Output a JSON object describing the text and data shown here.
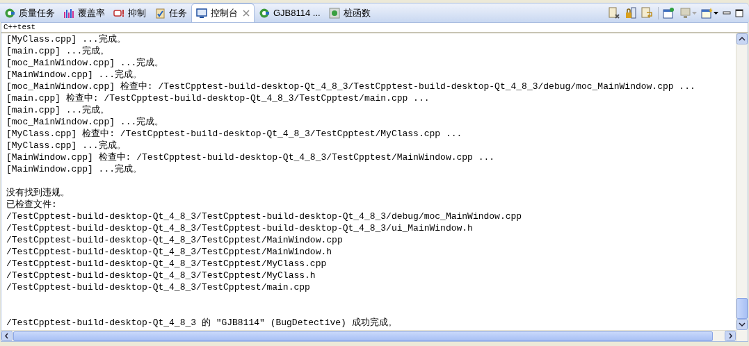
{
  "tabs": [
    {
      "label": "质量任务",
      "kind": "quality",
      "selected": false
    },
    {
      "label": "覆盖率",
      "kind": "coverage",
      "selected": false
    },
    {
      "label": "抑制",
      "kind": "suppress",
      "selected": false
    },
    {
      "label": "任务",
      "kind": "tasks",
      "selected": false
    },
    {
      "label": "控制台",
      "kind": "console",
      "selected": true
    },
    {
      "label": "GJB8114 ...",
      "kind": "quality",
      "selected": false
    },
    {
      "label": "桩函数",
      "kind": "stubs",
      "selected": false
    }
  ],
  "console": {
    "title": "C++test",
    "sections": [
      {
        "kind": "log",
        "lines": [
          "[MyClass.cpp] ...完成。",
          "[main.cpp] ...完成。",
          "[moc_MainWindow.cpp] ...完成。",
          "[MainWindow.cpp] ...完成。",
          "[moc_MainWindow.cpp] 检查中: /TestCpptest-build-desktop-Qt_4_8_3/TestCpptest-build-desktop-Qt_4_8_3/debug/moc_MainWindow.cpp ...",
          "[main.cpp] 检查中: /TestCpptest-build-desktop-Qt_4_8_3/TestCpptest/main.cpp ...",
          "[main.cpp] ...完成。",
          "[moc_MainWindow.cpp] ...完成。",
          "[MyClass.cpp] 检查中: /TestCpptest-build-desktop-Qt_4_8_3/TestCpptest/MyClass.cpp ...",
          "[MyClass.cpp] ...完成。",
          "[MainWindow.cpp] 检查中: /TestCpptest-build-desktop-Qt_4_8_3/TestCpptest/MainWindow.cpp ...",
          "[MainWindow.cpp] ...完成。"
        ]
      },
      {
        "kind": "summary",
        "lines": [
          "没有找到违规。",
          "已检查文件:",
          "/TestCpptest-build-desktop-Qt_4_8_3/TestCpptest-build-desktop-Qt_4_8_3/debug/moc_MainWindow.cpp",
          "/TestCpptest-build-desktop-Qt_4_8_3/TestCpptest-build-desktop-Qt_4_8_3/ui_MainWindow.h",
          "/TestCpptest-build-desktop-Qt_4_8_3/TestCpptest/MainWindow.cpp",
          "/TestCpptest-build-desktop-Qt_4_8_3/TestCpptest/MainWindow.h",
          "/TestCpptest-build-desktop-Qt_4_8_3/TestCpptest/MyClass.cpp",
          "/TestCpptest-build-desktop-Qt_4_8_3/TestCpptest/MyClass.h",
          "/TestCpptest-build-desktop-Qt_4_8_3/TestCpptest/main.cpp"
        ]
      },
      {
        "kind": "result",
        "lines": [
          "/TestCpptest-build-desktop-Qt_4_8_3 的 \"GJB8114\" (BugDetective) 成功完成。"
        ]
      }
    ]
  }
}
